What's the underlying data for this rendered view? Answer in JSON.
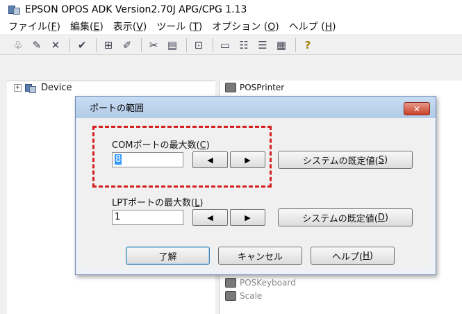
{
  "window": {
    "title": "EPSON OPOS ADK Version2.70J APG/CPG 1.13"
  },
  "menu": [
    {
      "label": "ファイル(",
      "acc": "F",
      "tail": ")"
    },
    {
      "label": "編集(",
      "acc": "E",
      "tail": ")"
    },
    {
      "label": "表示(",
      "acc": "V",
      "tail": ")"
    },
    {
      "label": "ツール (",
      "acc": "T",
      "tail": ")"
    },
    {
      "label": "オプション (",
      "acc": "O",
      "tail": ")"
    },
    {
      "label": "ヘルプ (",
      "acc": "H",
      "tail": ")"
    }
  ],
  "toolbar": {
    "icons": [
      "connect-icon",
      "wizard-icon",
      "delete-icon",
      "check-icon",
      "add-device-icon",
      "edit-device-icon",
      "cut-icon",
      "paste-icon",
      "properties-icon",
      "large-icons-icon",
      "small-icons-icon",
      "list-view-icon",
      "details-view-icon",
      "help-icon"
    ],
    "glyphs": [
      "♧",
      "✎",
      "✕",
      "✔",
      "⊞",
      "✐",
      "✂",
      "▤",
      "⊡",
      "▭",
      "☷",
      "☰",
      "▦",
      "?"
    ]
  },
  "tree": {
    "expander": "+",
    "root_label": "Device"
  },
  "list": {
    "items": [
      "POSPrinter",
      "POSKeyboard",
      "Scale"
    ]
  },
  "dialog": {
    "title": "ポートの範囲",
    "close_glyph": "✕",
    "com": {
      "label": "COMポートの最大数(",
      "acc": "C",
      "tail": ")",
      "value": "8",
      "default_label": "システムの既定値(",
      "default_acc": "S",
      "default_tail": ")"
    },
    "lpt": {
      "label": "LPTポートの最大数(",
      "acc": "L",
      "tail": ")",
      "value": "1",
      "default_label": "システムの既定値(",
      "default_acc": "D",
      "default_tail": ")"
    },
    "left_arrow": "◀",
    "right_arrow": "▶",
    "ok_label": "了解",
    "cancel_label": "キャンセル",
    "help_label": "ヘルプ(",
    "help_acc": "H",
    "help_tail": ")"
  },
  "colors": {
    "highlight": "#d41f1f",
    "close_button": "#c9402a",
    "title_gradient": "#b2cbe8"
  }
}
